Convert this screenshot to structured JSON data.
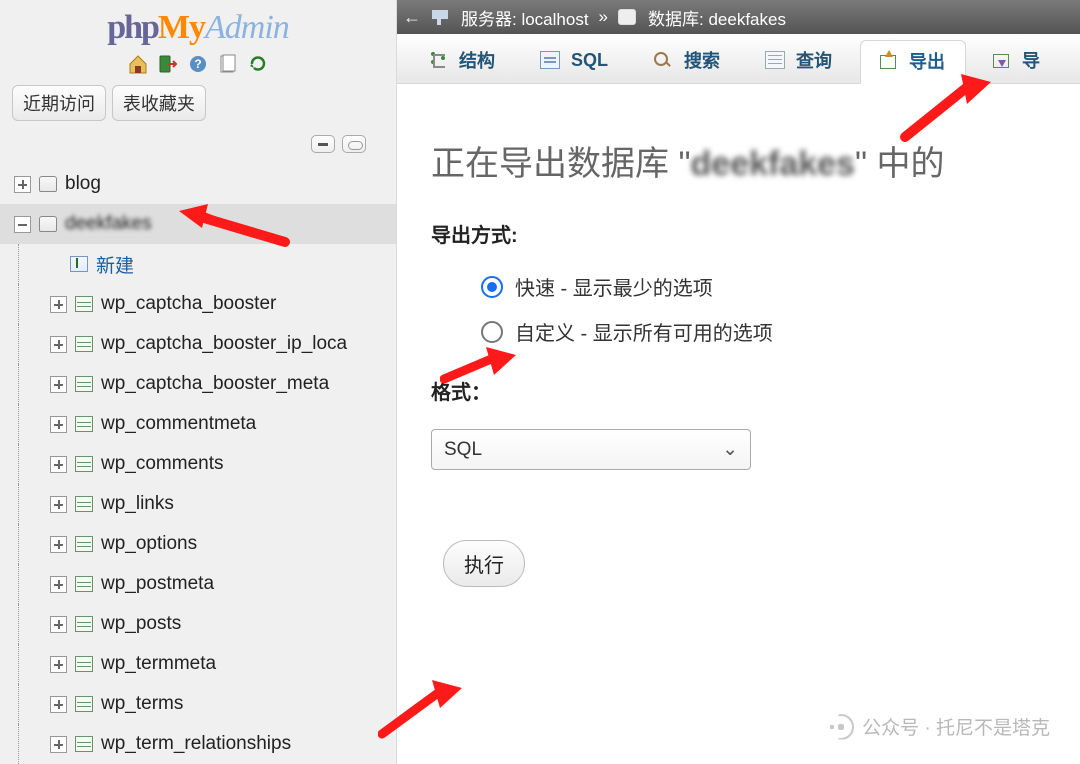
{
  "logo": {
    "p1": "php",
    "p2": "My",
    "p3": "Admin"
  },
  "sidebar": {
    "recent_tab": "近期访问",
    "fav_tab": "表收藏夹",
    "db1": "blog",
    "db2_blurred": "deekfakes",
    "new_label": "新建",
    "tables": [
      "wp_captcha_booster",
      "wp_captcha_booster_ip_loca",
      "wp_captcha_booster_meta",
      "wp_commentmeta",
      "wp_comments",
      "wp_links",
      "wp_options",
      "wp_postmeta",
      "wp_posts",
      "wp_termmeta",
      "wp_terms",
      "wp_term_relationships"
    ]
  },
  "breadcrumb": {
    "server_label": "服务器: localhost",
    "sep": "»",
    "db_label": "数据库: deekfakes"
  },
  "tabs": {
    "structure": "结构",
    "sql": "SQL",
    "search": "搜索",
    "query": "查询",
    "export": "导出",
    "import": "导"
  },
  "page_title_prefix": "正在导出数据库 \"",
  "page_title_blurred": "deekfakes",
  "page_title_suffix": "\" 中的",
  "export_method": {
    "label": "导出方式:",
    "quick": "快速 - 显示最少的选项",
    "custom": "自定义 - 显示所有可用的选项"
  },
  "format": {
    "label": "格式：",
    "selected": "SQL"
  },
  "go_button": "执行",
  "watermark": "公众号 · 托尼不是塔克"
}
